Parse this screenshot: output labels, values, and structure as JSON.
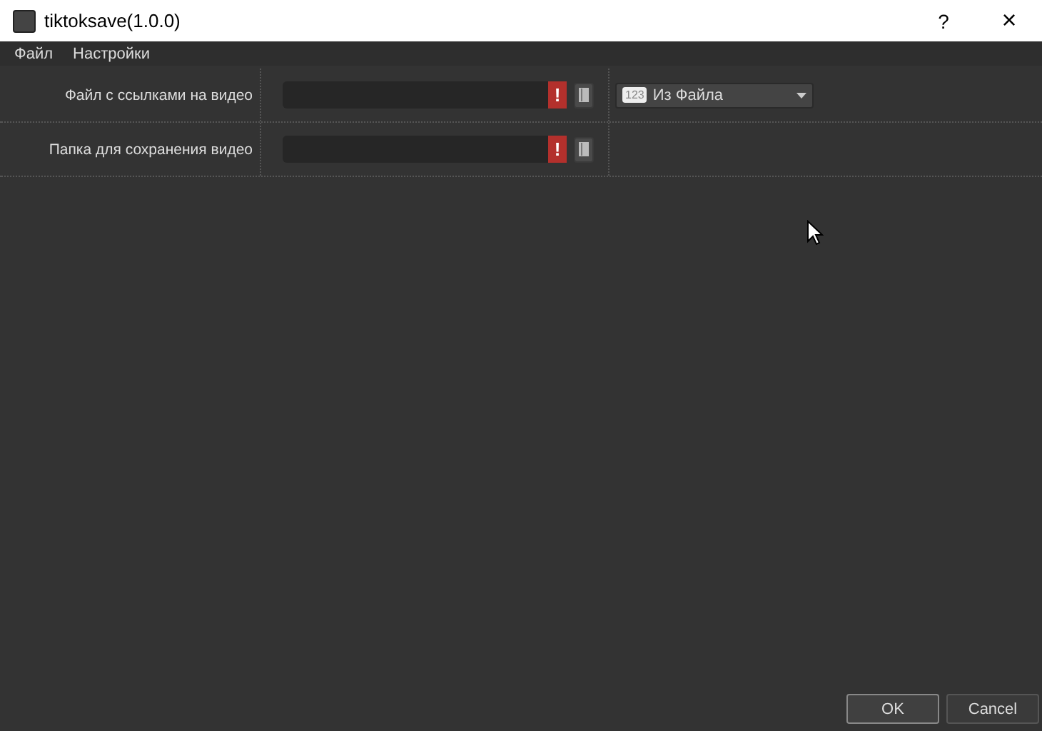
{
  "window": {
    "title": "tiktoksave(1.0.0)",
    "help": "?",
    "close": "×"
  },
  "menu": [
    "Файл",
    "Настройки"
  ],
  "rows": [
    {
      "label": "Файл с ссылками на видео",
      "warning": "!",
      "combo": {
        "badge": "123",
        "value": "Из Файла"
      }
    },
    {
      "label": "Папка для сохранения видео",
      "warning": "!"
    }
  ],
  "buttons": [
    {
      "label": "OK",
      "selected": true
    },
    {
      "label": "Cancel",
      "selected": false
    }
  ]
}
